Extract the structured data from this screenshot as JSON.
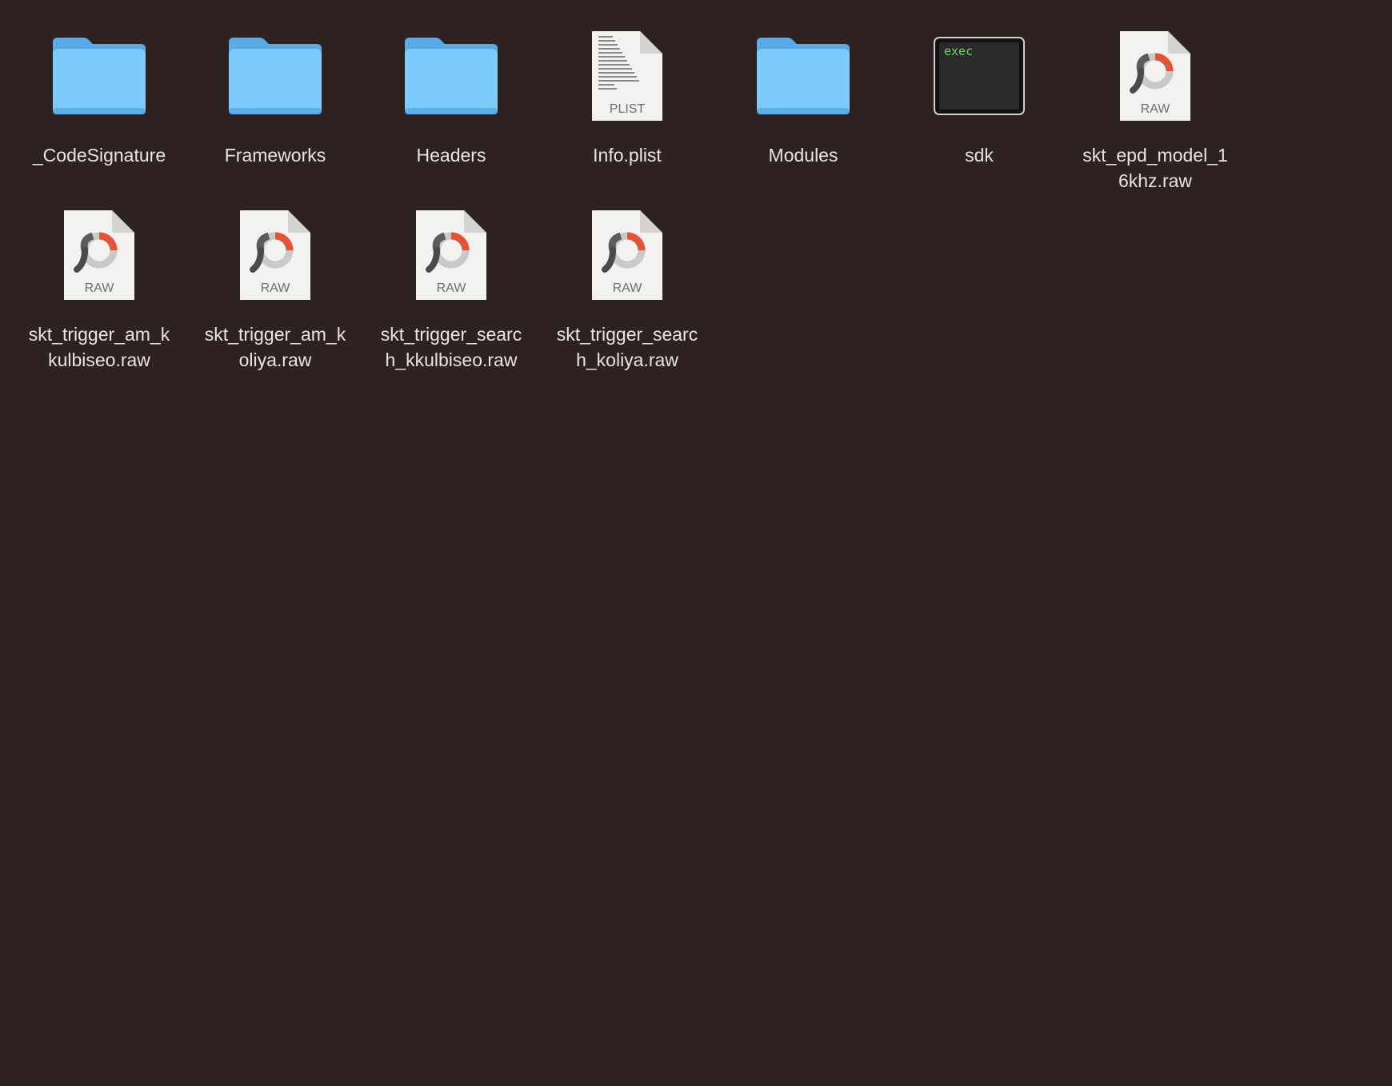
{
  "window": {
    "background": "#2d2220"
  },
  "colors": {
    "folder_body": "#7ccbfa",
    "folder_back": "#5aaae8",
    "raw_accent": "#e0553a",
    "exec_text": "#6cd26b"
  },
  "items": [
    {
      "name": "_CodeSignature",
      "label": "_CodeSignature",
      "icon": "folder-icon",
      "kind": "folder"
    },
    {
      "name": "Frameworks",
      "label": "Frameworks",
      "icon": "folder-icon",
      "kind": "folder"
    },
    {
      "name": "Headers",
      "label": "Headers",
      "icon": "folder-icon",
      "kind": "folder"
    },
    {
      "name": "Info.plist",
      "label": "Info.plist",
      "icon": "plist-file-icon",
      "kind": "plist",
      "badge": "PLIST"
    },
    {
      "name": "Modules",
      "label": "Modules",
      "icon": "folder-icon",
      "kind": "folder"
    },
    {
      "name": "sdk",
      "label": "sdk",
      "icon": "exec-terminal-icon",
      "kind": "exec",
      "badge": "exec"
    },
    {
      "name": "skt_epd_model_16khz.raw",
      "label": "skt_epd_model_1\n6khz.raw",
      "icon": "raw-file-icon",
      "kind": "raw",
      "badge": "RAW"
    },
    {
      "name": "skt_trigger_am_kkulbiseo.raw",
      "label": "skt_trigger_am_k\nkulbiseo.raw",
      "icon": "raw-file-icon",
      "kind": "raw",
      "badge": "RAW"
    },
    {
      "name": "skt_trigger_am_koliya.raw",
      "label": "skt_trigger_am_k\noliya.raw",
      "icon": "raw-file-icon",
      "kind": "raw",
      "badge": "RAW"
    },
    {
      "name": "skt_trigger_search_kkulbiseo.raw",
      "label": "skt_trigger_searc\nh_kkulbiseo.raw",
      "icon": "raw-file-icon",
      "kind": "raw",
      "badge": "RAW"
    },
    {
      "name": "skt_trigger_search_koliya.raw",
      "label": "skt_trigger_searc\nh_koliya.raw",
      "icon": "raw-file-icon",
      "kind": "raw",
      "badge": "RAW"
    }
  ]
}
